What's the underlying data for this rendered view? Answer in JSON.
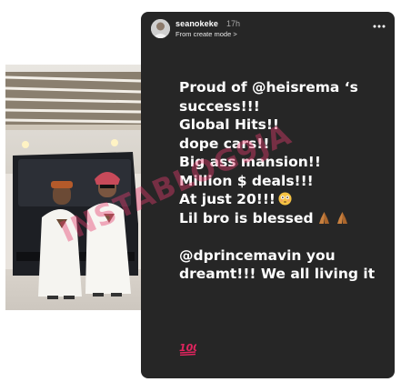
{
  "story": {
    "username": "seanokeke",
    "time": "17h",
    "subtitle": "From create mode >",
    "lines": [
      "Proud of @heisrema ‘s",
      "success!!!",
      "Global Hits!!",
      "dope cars!!",
      "Big ass mansion!!",
      "Million $ deals!!!",
      "At just 20!!!",
      "Lil bro is blessed"
    ],
    "lines_after_gap": [
      "@dprincemavin you",
      "dreamt!!! We all living it"
    ],
    "emojis": [
      "flushed-face",
      "folded-hands",
      "folded-hands",
      "hundred-points"
    ]
  },
  "watermark": "INSTABLOG9JA",
  "colors": {
    "story_bg": "#262626",
    "text": "#ffffff",
    "muted": "#a8a8a8",
    "watermark": "#e43c6e",
    "hundred_red": "#e0245e"
  }
}
